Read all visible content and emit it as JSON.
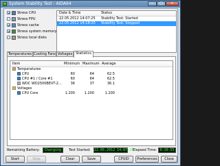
{
  "window": {
    "title": "System Stability Test - AIDA64"
  },
  "titlebar": {
    "minimize": "–",
    "maximize": "□",
    "close": "✕"
  },
  "stress_options": [
    {
      "label": "Stress CPU",
      "checked": true,
      "icon": "cpu-icon"
    },
    {
      "label": "Stress FPU",
      "checked": false,
      "icon": "fpu-icon"
    },
    {
      "label": "Stress cache",
      "checked": true,
      "icon": "cache-icon"
    },
    {
      "label": "Stress system memory",
      "checked": true,
      "icon": "memory-icon"
    },
    {
      "label": "Stress local disks",
      "checked": false,
      "icon": "disk-icon"
    }
  ],
  "log": {
    "col_date": "Date & Time",
    "col_status": "Status",
    "rows": [
      {
        "date": "22.05.2012 14:07:25",
        "status": "Stability Test: Started",
        "selected": false
      },
      {
        "date": "22.05.2012 14:18:20",
        "status": "Stability Test: Stopped",
        "selected": true
      }
    ]
  },
  "tabs": [
    {
      "label": "Temperatures",
      "active": false
    },
    {
      "label": "Cooling Fans",
      "active": false
    },
    {
      "label": "Voltages",
      "active": false
    },
    {
      "label": "Statistics",
      "active": true
    }
  ],
  "stats": {
    "col_item": "Item",
    "col_min": "Minimum",
    "col_max": "Maximum",
    "col_avg": "Average",
    "groups": [
      {
        "name": "Temperatures",
        "icon": "thermometer-icon",
        "rows": [
          {
            "item": "CPU",
            "min": "60",
            "max": "64",
            "avg": "62.5",
            "icon": "cpu-icon"
          },
          {
            "item": "CPU #1 / Core #1",
            "min": "60",
            "max": "64",
            "avg": "62.5",
            "icon": "cpu-core-icon"
          },
          {
            "item": "WDC WD2500BEVT-2...",
            "min": "36",
            "max": "37",
            "avg": "36.1",
            "icon": "disk-icon"
          }
        ]
      },
      {
        "name": "Voltages",
        "icon": "voltage-icon",
        "rows": [
          {
            "item": "CPU Core",
            "min": "1.200",
            "max": "1.200",
            "avg": "1.200",
            "icon": "cpu-icon"
          }
        ]
      }
    ]
  },
  "status": {
    "battery_label": "Remaining Battery:",
    "battery_value": "Charging",
    "started_label": "Test Started:",
    "started_value": "22.05.2012 14:07:25",
    "elapsed_label": "Elapsed Time:",
    "elapsed_value": "0:10:55"
  },
  "buttons": {
    "start": "Start",
    "stop": "Stop",
    "clear": "Clear",
    "save": "Save",
    "cpuid": "CPUID",
    "preferences": "Preferences",
    "close": "Close"
  },
  "colors": {
    "lcd_text": "#3dff3d",
    "selection": "#3399ff"
  }
}
